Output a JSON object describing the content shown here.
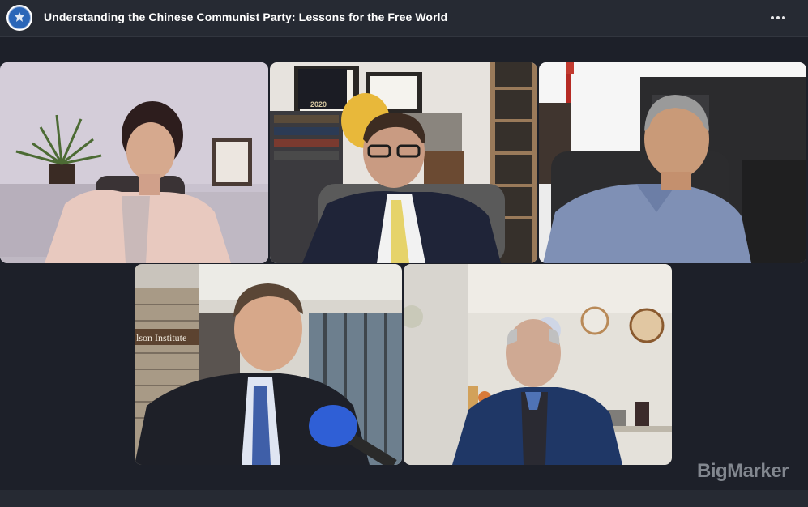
{
  "header": {
    "title": "Understanding the Chinese Communist Party: Lessons for the Free World"
  },
  "tiles": [
    {
      "id": "p1"
    },
    {
      "id": "p2",
      "book_title": "2020"
    },
    {
      "id": "p3"
    },
    {
      "id": "p4",
      "wall_sign": "lson Institute"
    },
    {
      "id": "p5"
    }
  ],
  "watermark": "BigMarker",
  "colors": {
    "background": "#1d2029",
    "header": "#262a33",
    "title_text": "#ffffff"
  },
  "icons": {
    "logo": "seal-icon",
    "more": "more-horizontal-icon"
  }
}
